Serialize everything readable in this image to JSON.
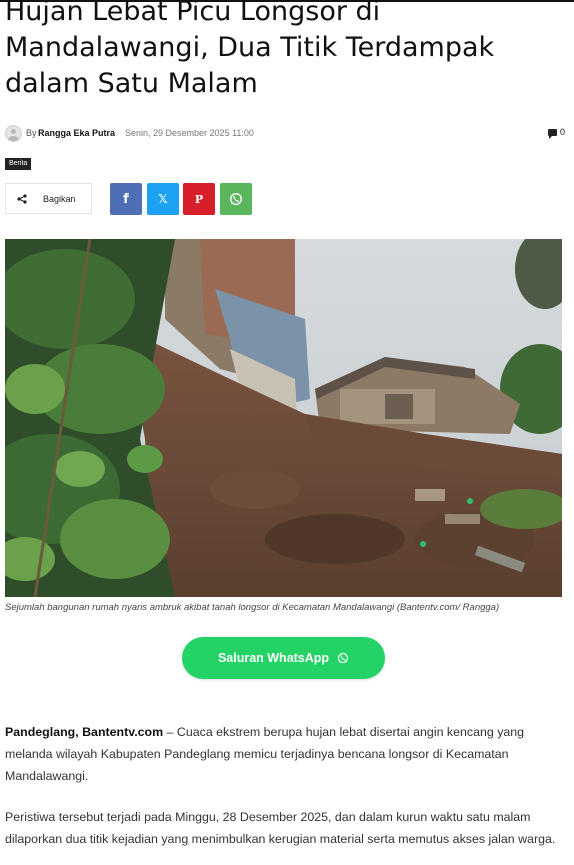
{
  "article": {
    "title": "Hujan Lebat Picu Longsor di Mandalawangi, Dua Titik Terdampak dalam Satu Malam",
    "by_prefix": "By",
    "author": "Rangga Eka Putra",
    "date": "Senin, 29 Desember 2025 11:00",
    "comments_count": "0",
    "category": "Berita"
  },
  "share": {
    "label": "Bagikan",
    "facebook_icon": "f",
    "twitter_icon": "𝕏",
    "pinterest_icon": "P"
  },
  "image": {
    "caption": "Sejumlah bangunan rumah nyaris ambruk akibat tanah longsor  di Kecamatan Mandalawangi (Bantentv.com/ Rangga)"
  },
  "whatsapp_channel": {
    "label": "Saluran WhatsApp"
  },
  "body": {
    "p1_dateline": "Pandeglang, Bantentv.com",
    "p1_text": " – Cuaca ekstrem berupa hujan lebat disertai angin kencang yang melanda wilayah Kabupaten Pandeglang memicu terjadinya bencana longsor di Kecamatan Mandalawangi.",
    "p2_text": "Peristiwa tersebut terjadi pada Minggu, 28 Desember 2025, dan dalam kurun waktu satu malam dilaporkan dua titik kejadian yang menimbulkan kerugian material serta memutus akses jalan warga."
  },
  "colors": {
    "facebook": "#4e6fb4",
    "twitter": "#1da1f2",
    "pinterest": "#d61f2b",
    "whatsapp": "#5ab55d",
    "whatsapp_channel": "#24d366"
  }
}
